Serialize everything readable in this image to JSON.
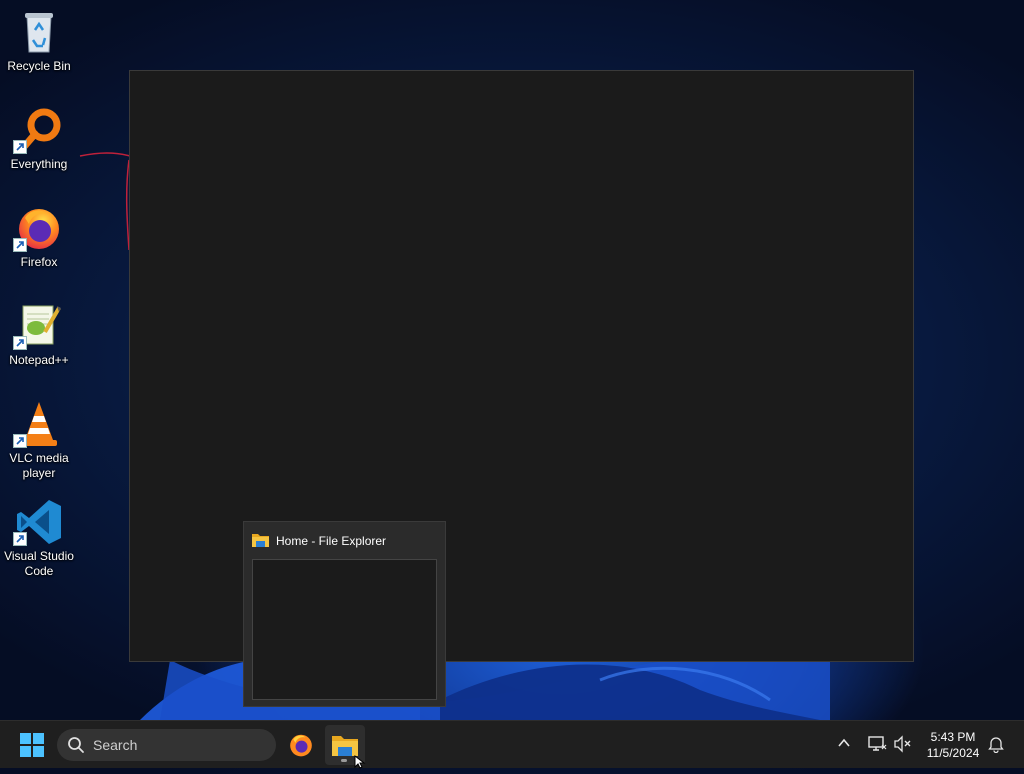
{
  "desktop": {
    "icons": [
      {
        "label": "Recycle Bin",
        "icon": "recycle-bin-icon"
      },
      {
        "label": "Everything",
        "icon": "everything-icon"
      },
      {
        "label": "Firefox",
        "icon": "firefox-icon"
      },
      {
        "label": "Notepad++",
        "icon": "notepadpp-icon"
      },
      {
        "label": "VLC media player",
        "icon": "vlc-icon"
      },
      {
        "label": "Visual Studio Code",
        "icon": "vscode-icon"
      }
    ]
  },
  "preview": {
    "title": "Home - File Explorer",
    "icon": "folder-icon"
  },
  "taskbar": {
    "search_placeholder": "Search",
    "pinned": [
      "firefox-icon",
      "file-explorer-icon"
    ],
    "active_app": "File Explorer"
  },
  "tray": {
    "time": "5:43 PM",
    "date": "11/5/2024",
    "icons": [
      "chevron-up-icon",
      "network-icon",
      "volume-muted-icon",
      "notification-bell-icon"
    ]
  },
  "colors": {
    "taskbar_bg": "#1f1f1f",
    "window_bg": "#1b1b1b",
    "accent": "#0078d4"
  }
}
